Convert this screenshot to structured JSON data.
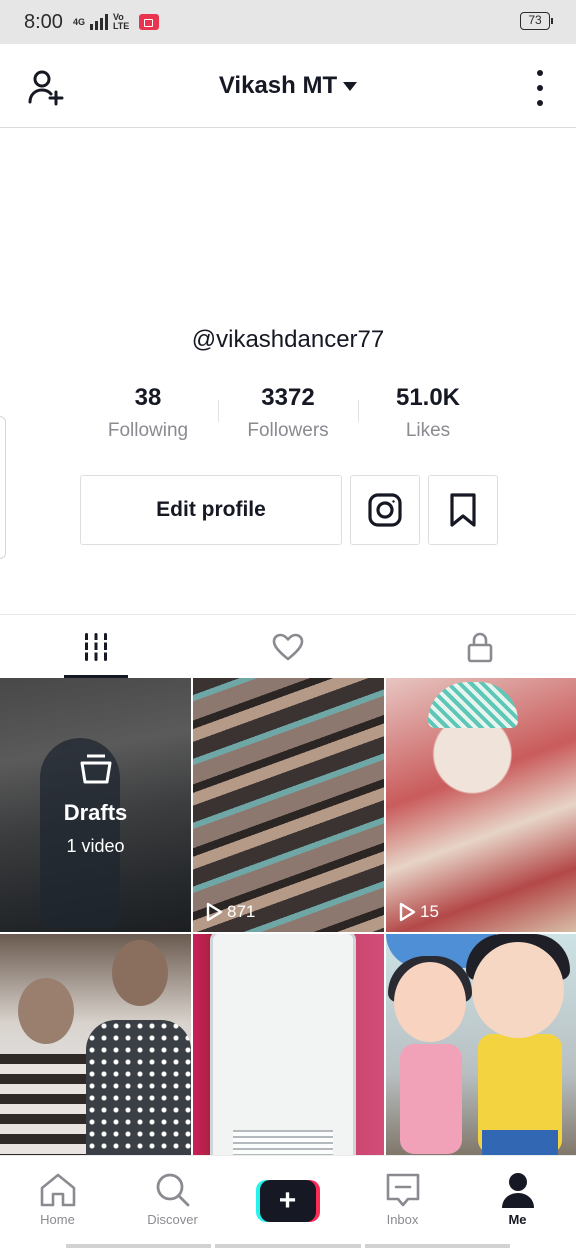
{
  "status_bar": {
    "time": "8:00",
    "network": "4G",
    "volte_top": "Vo",
    "volte_bottom": "LTE",
    "battery": "73"
  },
  "header": {
    "title": "Vikash MT",
    "add_friend_icon": "person-plus-icon",
    "menu_icon": "vertical-dots-icon"
  },
  "profile": {
    "username": "@vikashdancer77",
    "stats": [
      {
        "value": "38",
        "label": "Following"
      },
      {
        "value": "3372",
        "label": "Followers"
      },
      {
        "value": "51.0K",
        "label": "Likes"
      }
    ],
    "edit_profile_label": "Edit profile",
    "instagram_icon": "instagram-icon",
    "bookmark_icon": "bookmark-icon"
  },
  "tabs": [
    {
      "icon": "grid-icon",
      "active": true
    },
    {
      "icon": "heart-icon",
      "active": false
    },
    {
      "icon": "lock-icon",
      "active": false
    }
  ],
  "videos": {
    "drafts": {
      "title": "Drafts",
      "count": "1 video"
    },
    "items": [
      {
        "views": "871"
      },
      {
        "views": "15"
      }
    ]
  },
  "bottom_nav": {
    "items": [
      {
        "label": "Home",
        "icon": "home-icon"
      },
      {
        "label": "Discover",
        "icon": "search-icon"
      },
      {
        "label": "",
        "icon": "plus-icon"
      },
      {
        "label": "Inbox",
        "icon": "inbox-icon"
      },
      {
        "label": "Me",
        "icon": "person-icon",
        "active": true
      }
    ]
  },
  "colors": {
    "accent_cyan": "#25f4ee",
    "accent_red": "#fe2c55",
    "text_primary": "#161823",
    "text_secondary": "#8a8b91"
  }
}
